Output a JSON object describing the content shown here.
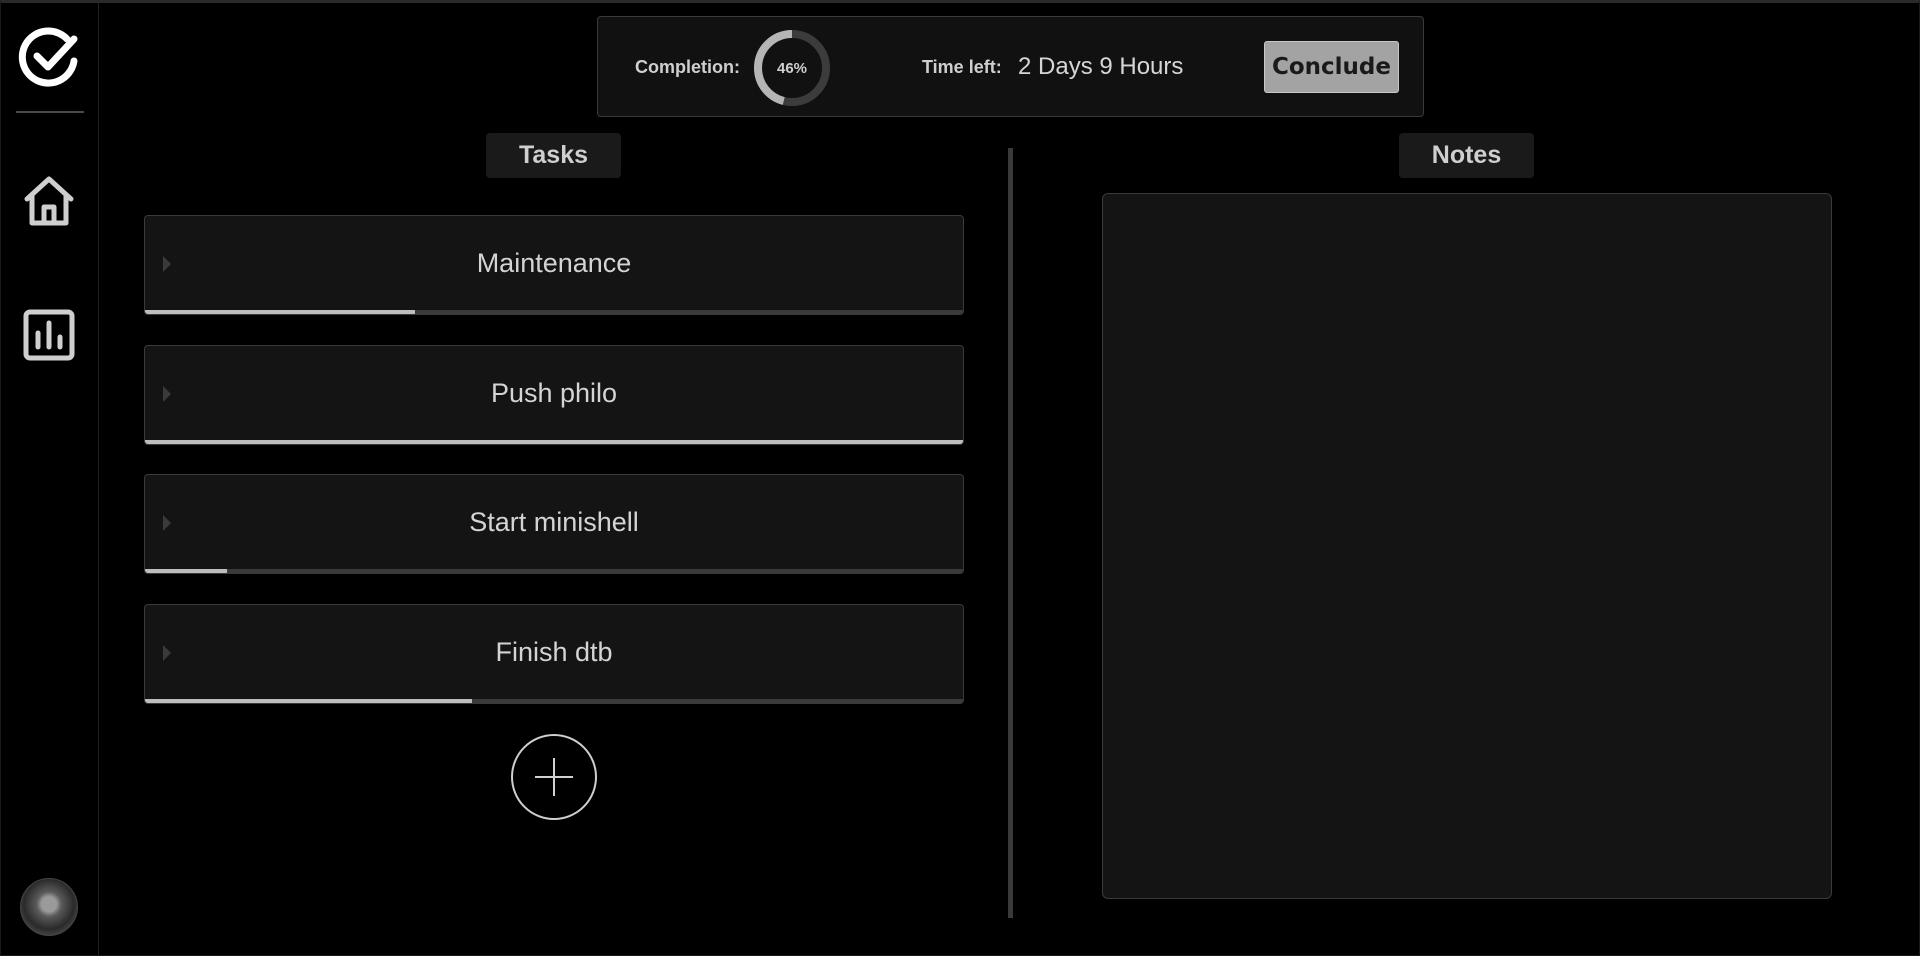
{
  "sidebar": {
    "logo_icon": "check-circle-icon",
    "nav": [
      {
        "name": "home",
        "icon": "home-icon"
      },
      {
        "name": "stats",
        "icon": "bar-chart-icon"
      }
    ],
    "avatar": "user-avatar"
  },
  "status": {
    "completion_label": "Completion:",
    "completion_percent": 46,
    "completion_text": "46%",
    "time_left_label": "Time left:",
    "time_left_value": "2 Days 9 Hours",
    "conclude_label": "Conclude"
  },
  "tasks": {
    "header": "Tasks",
    "items": [
      {
        "title": "Maintenance",
        "progress": 0.33
      },
      {
        "title": "Push philo",
        "progress": 1.0
      },
      {
        "title": "Start minishell",
        "progress": 0.1
      },
      {
        "title": "Finish dtb",
        "progress": 0.4
      }
    ],
    "add_icon": "plus-icon"
  },
  "notes": {
    "header": "Notes",
    "value": ""
  },
  "colors": {
    "background": "#000000",
    "panel": "#141414",
    "border": "#3a3a3a",
    "accent": "#bdbdbd",
    "button": "#a3a3a3"
  }
}
